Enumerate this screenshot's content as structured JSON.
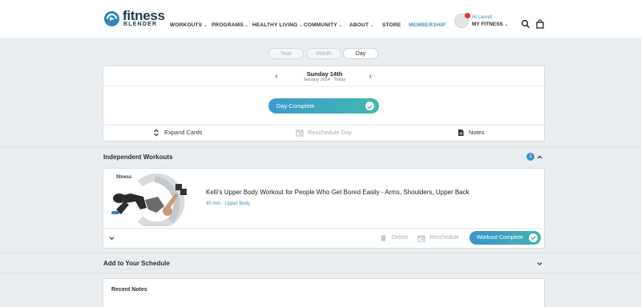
{
  "brand": {
    "name": "fitness",
    "sub": "BLENDER"
  },
  "nav": [
    {
      "label": "WORKOUTS",
      "caret": "⌄"
    },
    {
      "label": "PROGRAMS",
      "caret": "⌄"
    },
    {
      "label": "HEALTHY LIVING",
      "caret": "⌄"
    },
    {
      "label": "COMMUNITY",
      "caret": "⌄"
    },
    {
      "label": "ABOUT",
      "caret": "⌄"
    },
    {
      "label": "STORE",
      "caret": ""
    },
    {
      "label": "MEMBERSHIP",
      "caret": ""
    }
  ],
  "profile": {
    "greeting": "Hi Laurel!",
    "menu_label": "MY FITNESS",
    "caret": "⌄"
  },
  "icons": {
    "search": "search-icon",
    "cart": "shopping-bag-icon"
  },
  "view_toggle": {
    "options": [
      "Year",
      "Month",
      "Day"
    ],
    "selected": "Day"
  },
  "day": {
    "title": "Sunday 14th",
    "subtitle": "January 2024 · Today",
    "complete_label": "Day Complete",
    "actions": {
      "expand": "Expand Cards",
      "reschedule": "Reschedule Day",
      "notes": "Notes"
    }
  },
  "independent": {
    "title": "Independent Workouts",
    "count": "1",
    "workout": {
      "thumb_brand": "fitness",
      "title": "Kelli's Upper Body Workout for People Who Get Bored Easily - Arms, Shoulders, Upper Back",
      "meta": "40 min · Upper Body",
      "delete_label": "Delete",
      "reschedule_label": "Reschedule",
      "complete_label": "Workout Complete"
    }
  },
  "schedule": {
    "title": "Add to Your Schedule"
  },
  "notes": {
    "title": "Recent Notes"
  },
  "colors": {
    "accent_blue": "#3b94c9",
    "teal": "#3fb8b0",
    "badge_red": "#e0322e",
    "background": "#e9edf0"
  }
}
